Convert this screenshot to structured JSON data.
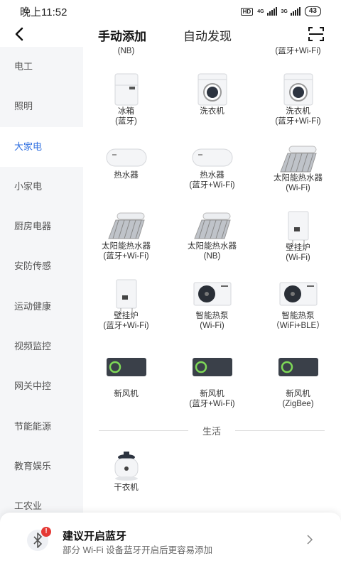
{
  "status": {
    "time": "晚上11:52",
    "hd": "HD",
    "net1": "4G",
    "net2": "3G",
    "battery": "43"
  },
  "header": {
    "tab_manual": "手动添加",
    "tab_auto": "自动发现"
  },
  "sidebar": {
    "items": [
      "电工",
      "照明",
      "大家电",
      "小家电",
      "厨房电器",
      "安防传感",
      "运动健康",
      "视频监控",
      "网关中控",
      "节能能源",
      "教育娱乐",
      "工农业"
    ],
    "active_index": 2
  },
  "devices": {
    "row0": [
      "(NB)",
      "",
      "(蓝牙+Wi-Fi)"
    ],
    "row1": [
      "冰箱\n(蓝牙)",
      "洗衣机",
      "洗衣机\n(蓝牙+Wi-Fi)"
    ],
    "row2": [
      "热水器",
      "热水器\n(蓝牙+Wi-Fi)",
      "太阳能热水器\n(Wi-Fi)"
    ],
    "row3": [
      "太阳能热水器\n(蓝牙+Wi-Fi)",
      "太阳能热水器\n(NB)",
      "壁挂炉\n(Wi-Fi)"
    ],
    "row4": [
      "壁挂炉\n(蓝牙+Wi-Fi)",
      "智能热泵\n(Wi-Fi)",
      "智能热泵\n（WiFi+BLE）"
    ],
    "row5": [
      "新风机",
      "新风机\n(蓝牙+Wi-Fi)",
      "新风机\n(ZigBee)"
    ],
    "section_life": "生活",
    "row6": [
      "干衣机"
    ]
  },
  "banner": {
    "title": "建议开启蓝牙",
    "subtitle": "部分 Wi-Fi 设备蓝牙开启后更容易添加",
    "badge": "!"
  },
  "colors": {
    "accent": "#2f6fe0",
    "sidebar_bg": "#f5f6f8",
    "badge": "#e53935"
  }
}
